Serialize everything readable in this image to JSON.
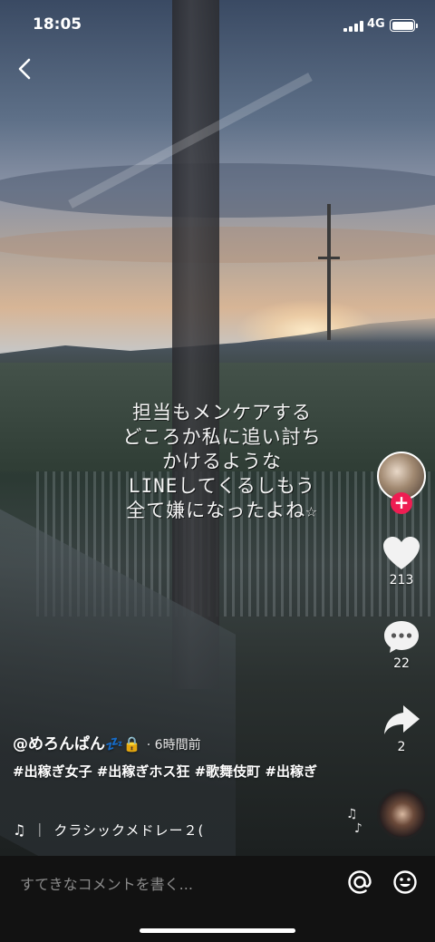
{
  "status_bar": {
    "time": "18:05",
    "network": "4G"
  },
  "overlay_text": [
    "担当もメンケアする",
    "どころか私に追い討ち",
    "かけるような",
    "LINEしてくるしもう",
    "全て嫌になったよね☆"
  ],
  "actions": {
    "follow_symbol": "+",
    "likes": "213",
    "comments": "22",
    "shares": "2"
  },
  "post": {
    "username": "@めろんぱん",
    "username_emojis": "💤🔒",
    "meta": "· 6時間前",
    "hashtags": "#出稼ぎ女子 #出稼ぎホス狂 #歌舞伎町 #出稼ぎ",
    "music_title": "クラシックメドレー２(",
    "music_note": "♫",
    "music_sep": "｜"
  },
  "comment_bar": {
    "placeholder": "すてきなコメントを書く..."
  },
  "icons": [
    "back-icon",
    "heart-icon",
    "comment-icon",
    "share-icon",
    "mention-icon",
    "emoji-icon",
    "music-note-icon"
  ],
  "colors": {
    "follow_badge": "#ee1d52",
    "bottom_bar": "#121212"
  }
}
